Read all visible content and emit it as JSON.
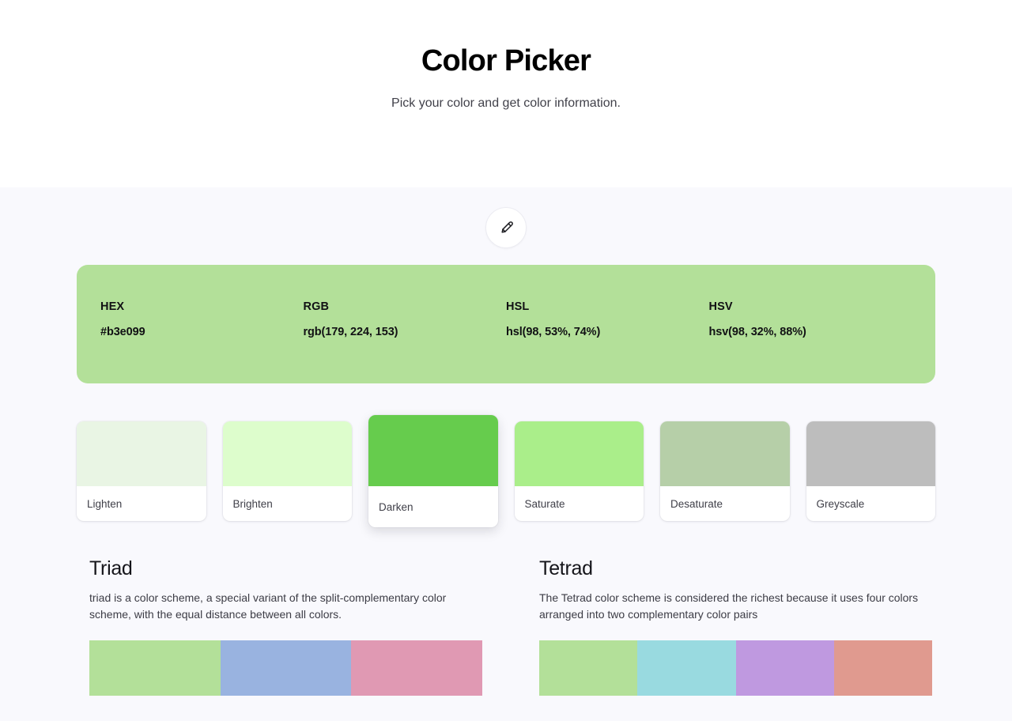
{
  "header": {
    "title": "Color Picker",
    "subtitle": "Pick your color and get color information."
  },
  "picker": {
    "icon": "eyedropper-icon",
    "aria_label": "Pick a color"
  },
  "color": {
    "base_hex": "#b3e099",
    "panel_background": "#b3e099",
    "fields": [
      {
        "label": "HEX",
        "value": "#b3e099"
      },
      {
        "label": "RGB",
        "value": "rgb(179, 224, 153)"
      },
      {
        "label": "HSL",
        "value": "hsl(98, 53%, 74%)"
      },
      {
        "label": "HSV",
        "value": "hsv(98, 32%, 88%)"
      }
    ]
  },
  "variations": [
    {
      "label": "Lighten",
      "color": "#e9f5e4",
      "elevated": false
    },
    {
      "label": "Brighten",
      "color": "#ddfdcc",
      "elevated": false
    },
    {
      "label": "Darken",
      "color": "#66cc4d",
      "elevated": true
    },
    {
      "label": "Saturate",
      "color": "#aaee8a",
      "elevated": false
    },
    {
      "label": "Desaturate",
      "color": "#b6cfa8",
      "elevated": false
    },
    {
      "label": "Greyscale",
      "color": "#bdbdbd",
      "elevated": false
    }
  ],
  "schemes": [
    {
      "title": "Triad",
      "description": "triad is a color scheme, a special variant of the split-complementary color scheme, with the equal distance between all colors.",
      "colors": [
        "#b3e099",
        "#99b3e0",
        "#e099b3"
      ]
    },
    {
      "title": "Tetrad",
      "description": "The Tetrad color scheme is considered the richest because it uses four colors arranged into two complementary color pairs",
      "colors": [
        "#b3e099",
        "#99dae0",
        "#bf99e0",
        "#e09a8f"
      ]
    }
  ]
}
